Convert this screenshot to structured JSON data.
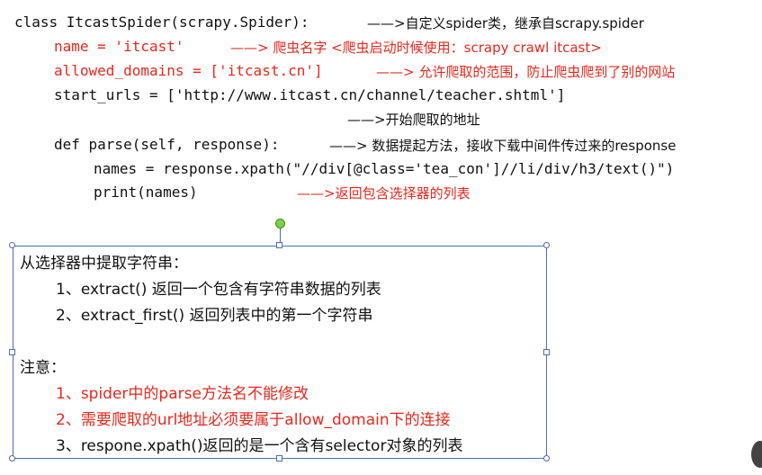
{
  "code": {
    "line1": "class ItcastSpider(scrapy.Spider):",
    "line2": "name = 'itcast'",
    "line3": "allowed_domains = ['itcast.cn']",
    "line4": "start_urls = ['http://www.itcast.cn/channel/teacher.shtml']",
    "line5": "def parse(self, response):",
    "line6": "names = response.xpath(\"//div[@class='tea_con']//li/div/h3/text()\")",
    "line7": "print(names)"
  },
  "annotations": {
    "a1": "——>自定义spider类，继承自scrapy.spider",
    "a2": "——> 爬虫名字 <爬虫启动时候使用：scrapy crawl itcast>",
    "a3": "——> 允许爬取的范围，防止爬虫爬到了别的网站",
    "a4": "——>开始爬取的地址",
    "a5": "——> 数据提起方法，接收下载中间件传过来的response",
    "a7": "——>返回包含选择器的列表"
  },
  "box": {
    "heading": "从选择器中提取字符串：",
    "item1": "1、extract()  返回一个包含有字符串数据的列表",
    "item2": "2、extract_first() 返回列表中的第一个字符串",
    "note_heading": "注意：",
    "note1": "1、spider中的parse方法名不能修改",
    "note2": "2、需要爬取的url地址必须要属于allow_domain下的连接",
    "note3": "3、respone.xpath()返回的是一个含有selector对象的列表"
  },
  "colors": {
    "black": "#111111",
    "red": "#e8271b",
    "frame": "#4a6fa5",
    "rotation_handle": "#7bd34a"
  }
}
